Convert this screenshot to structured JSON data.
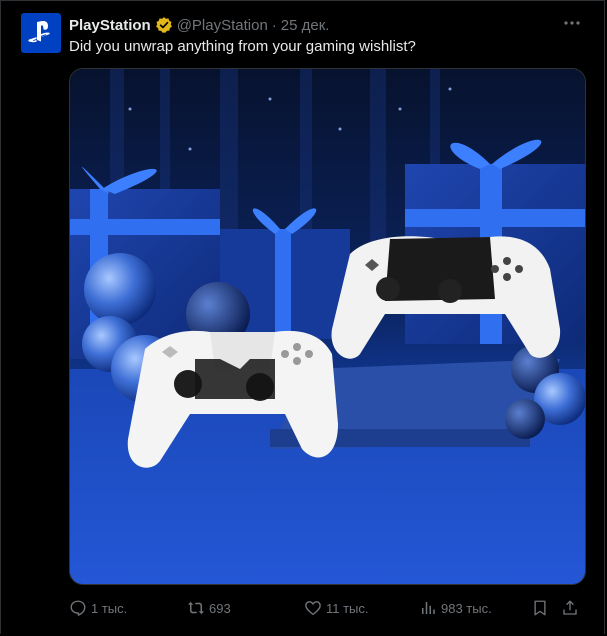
{
  "post": {
    "author": "PlayStation",
    "handle": "@PlayStation",
    "separator": "·",
    "date": "25 дек.",
    "text": "Did you unwrap anything from your gaming wishlist?",
    "media_icon": "playstation-logo-icon",
    "verified_color": "#e2b719",
    "avatar_color": "#0041c1"
  },
  "actions": {
    "replies": "1 тыс.",
    "reposts": "693",
    "likes": "11 тыс.",
    "views": "983 тыс."
  }
}
